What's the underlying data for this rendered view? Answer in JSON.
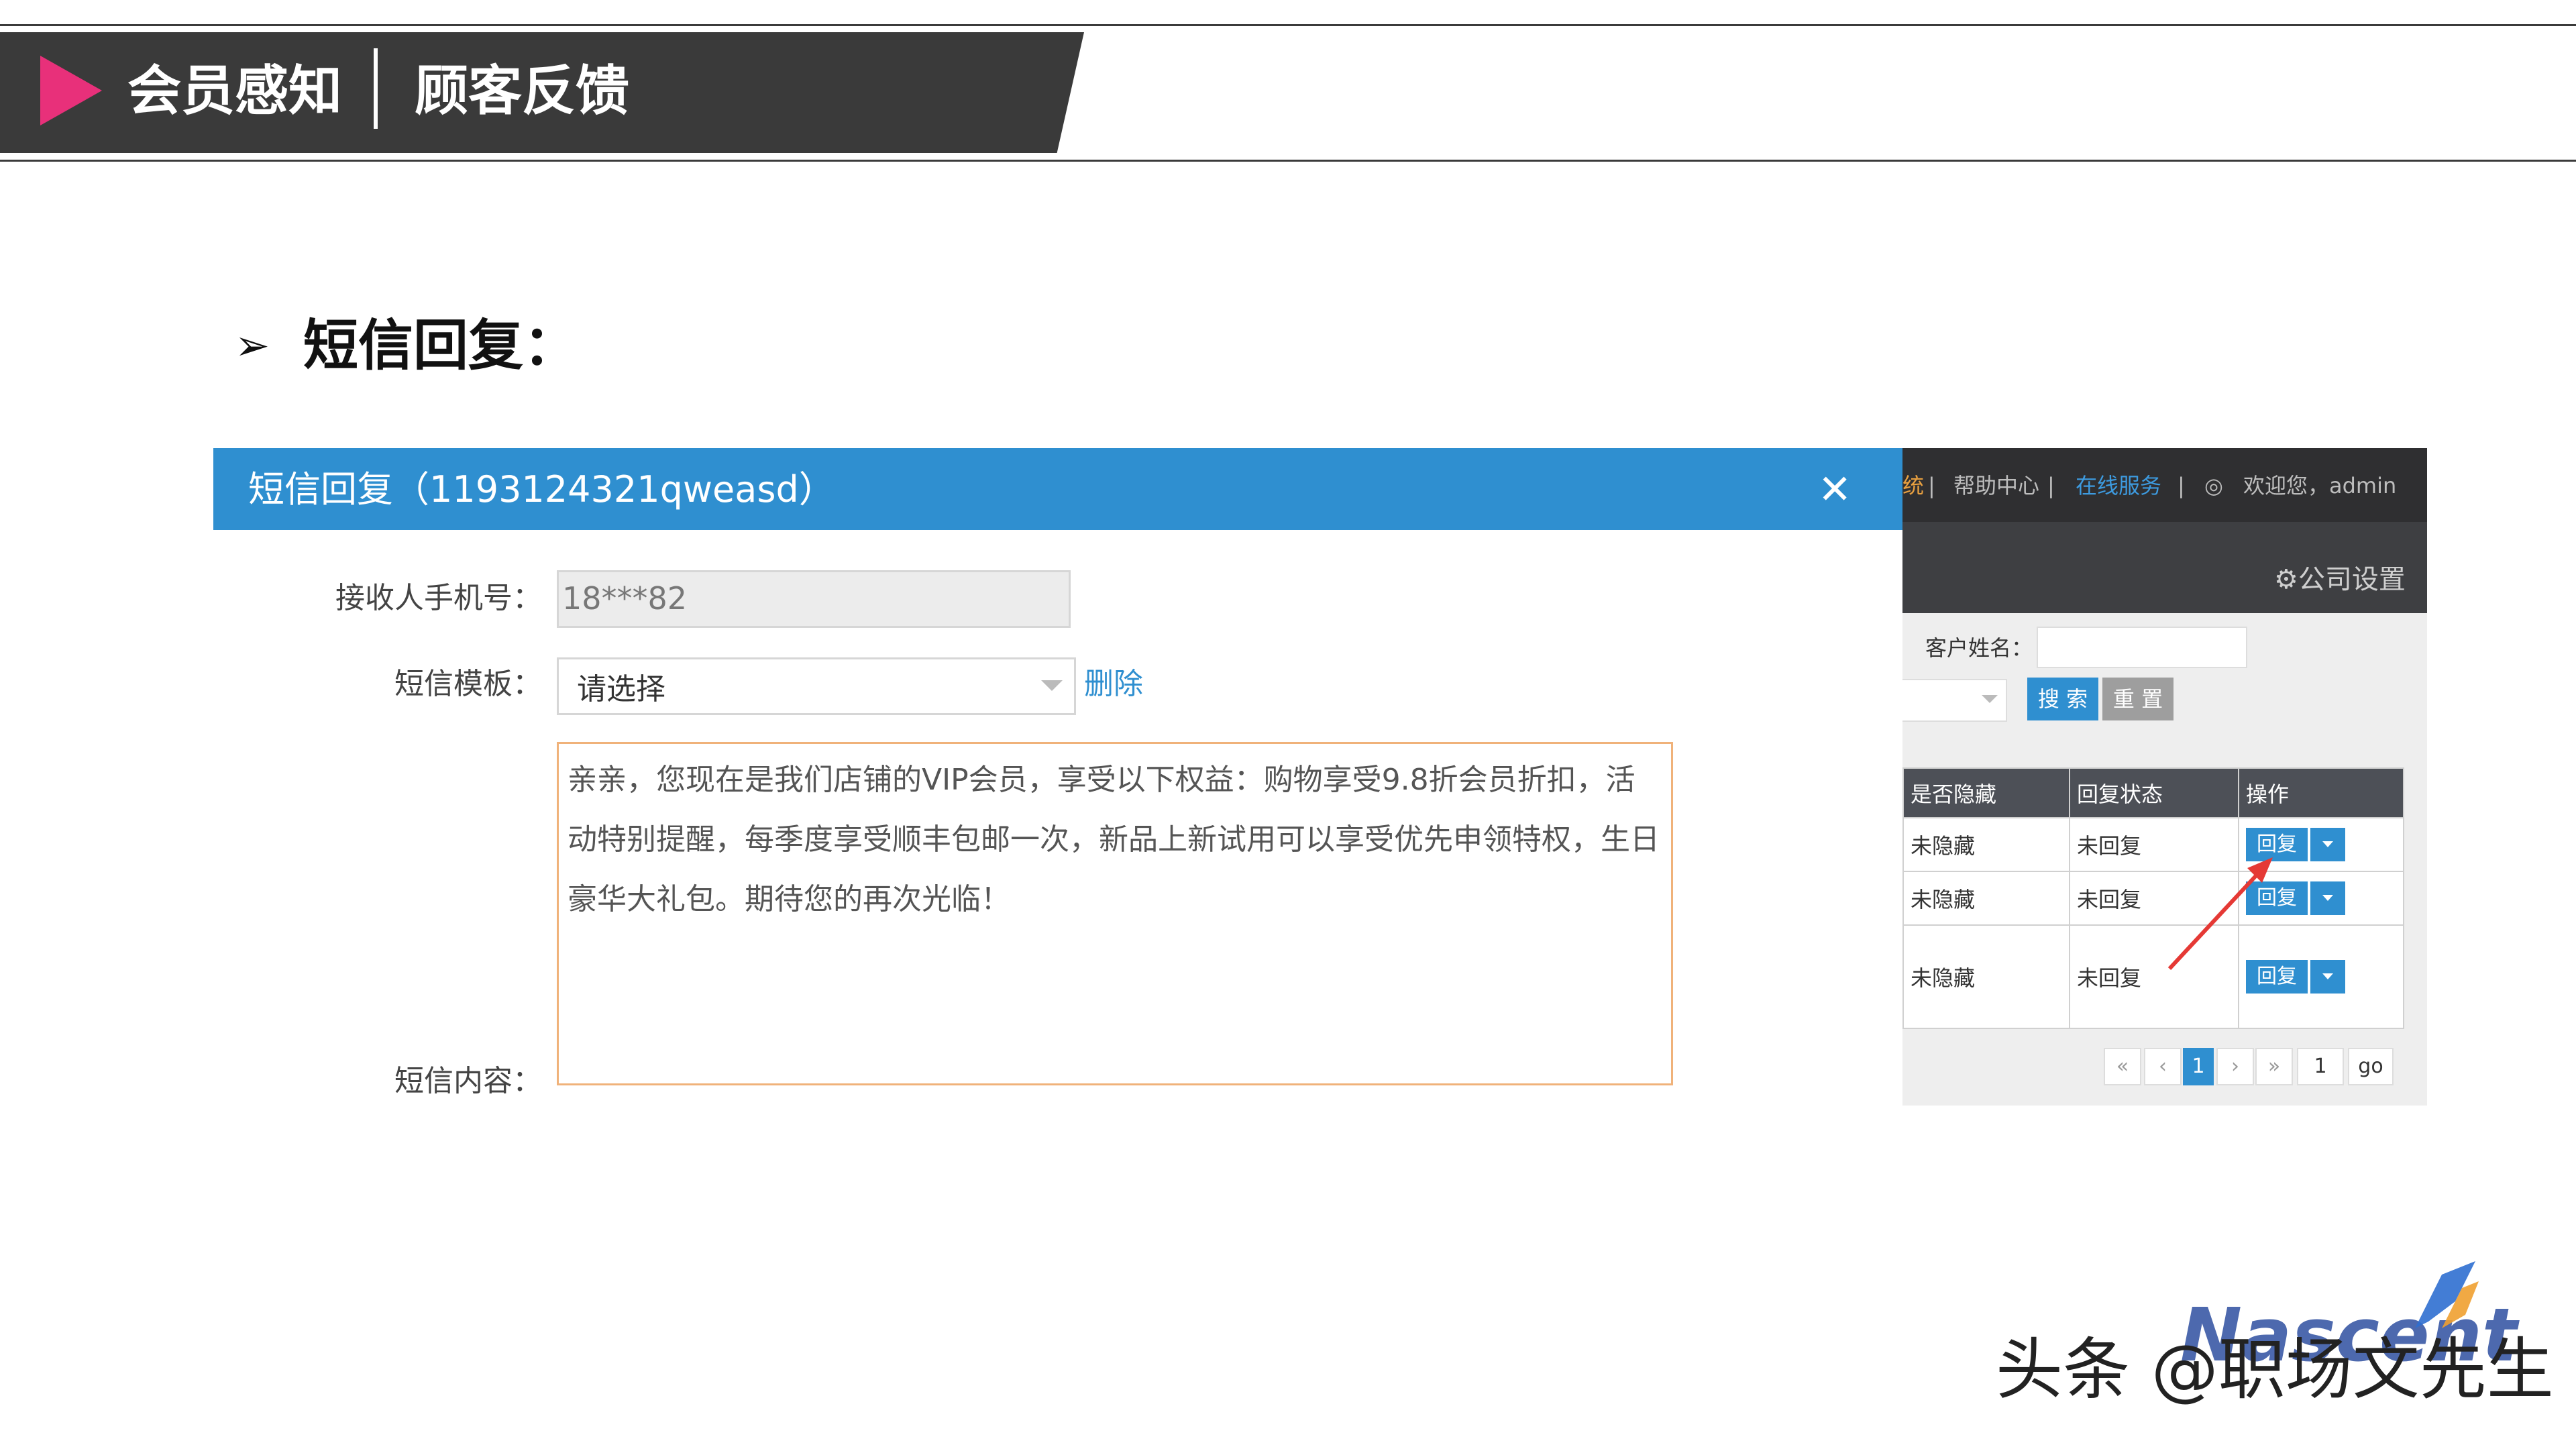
{
  "header": {
    "section": "会员感知",
    "title": "顾客反馈"
  },
  "subtitle": {
    "bullet": "➢",
    "text": "短信回复："
  },
  "dialog": {
    "title": "短信回复（1193124321qweasd）",
    "close_icon": "close-icon",
    "phone_label": "接收人手机号：",
    "phone_value": "18***82",
    "template_label": "短信模板：",
    "template_value": "请选择",
    "delete_label": "删除",
    "content_label": "短信内容：",
    "content_value": "亲亲，您现在是我们店铺的VIP会员，享受以下权益：购物享受9.8折会员折扣，活动特别提醒，每季度享受顺丰包邮一次，新品上新试用可以享受优先申领特权，生日豪华大礼包。期待您的再次光临！",
    "accent_color": "#2f8fd0",
    "content_border_color": "#f0b27a"
  },
  "right_panel": {
    "top_links": [
      "统",
      "帮助中心",
      "在线服务"
    ],
    "separator": "|",
    "welcome": "欢迎您，admin",
    "user_icon": "user-icon",
    "settings": "⚙公司设置",
    "customer_name_label": "客户姓名：",
    "search_label": "搜 索",
    "reset_label": "重 置",
    "table": {
      "headers": [
        "是否隐藏",
        "回复状态",
        "操作"
      ],
      "rows": [
        {
          "hidden": "未隐藏",
          "status": "未回复",
          "action": "回复"
        },
        {
          "hidden": "未隐藏",
          "status": "未回复",
          "action": "回复"
        },
        {
          "hidden": "未隐藏",
          "status": "未回复",
          "action": "回复"
        }
      ]
    },
    "pagination": {
      "first": "«",
      "prev": "‹",
      "current": "1",
      "next": "›",
      "last": "»",
      "page_input": "1",
      "go": "go"
    }
  },
  "watermark": {
    "logo": "Nascent",
    "text": "头条 @职场文先生"
  }
}
